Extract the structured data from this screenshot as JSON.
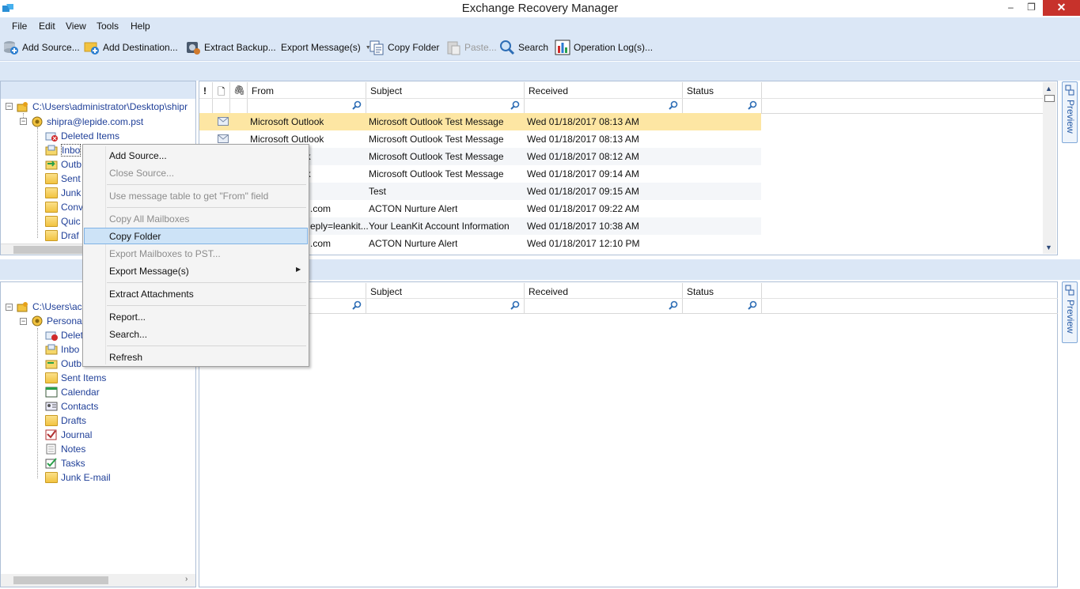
{
  "window": {
    "title": "Exchange Recovery Manager",
    "minimize": "–",
    "maximize": "❐",
    "close": "✕"
  },
  "menu": [
    "File",
    "Edit",
    "View",
    "Tools",
    "Help"
  ],
  "toolbar": [
    {
      "label": "Add Source...",
      "icon": "add-source-icon"
    },
    {
      "label": "Add Destination...",
      "icon": "add-destination-icon"
    },
    {
      "label": "Extract Backup...",
      "icon": "extract-backup-icon"
    },
    {
      "label": "Export Message(s)",
      "icon": "dropdown-arrow-icon"
    },
    {
      "label": "Copy Folder",
      "icon": "copy-folder-icon"
    },
    {
      "label": "Paste...",
      "icon": "paste-icon",
      "disabled": true
    },
    {
      "label": "Search",
      "icon": "search-icon"
    },
    {
      "label": "Operation Log(s)...",
      "icon": "operation-log-icon"
    }
  ],
  "source_tree": {
    "root": "C:\\Users\\administrator\\Desktop\\shipr",
    "mailbox": "shipra@lepide.com.pst",
    "folders": [
      "Deleted Items",
      "Inbo",
      "Outb",
      "Sent",
      "Junk",
      "Conv",
      "Quic",
      "Draf"
    ]
  },
  "dest_tree": {
    "root": "C:\\Users\\ac",
    "mailbox": "Persona",
    "folders": [
      "Delet",
      "Inbo",
      "Outb",
      "Sent Items",
      "Calendar",
      "Contacts",
      "Drafts",
      "Journal",
      "Notes",
      "Tasks",
      "Junk E-mail"
    ]
  },
  "grid_top": {
    "icon_headers": [
      "!",
      "🗋",
      "🖇"
    ],
    "headers": [
      "From",
      "Subject",
      "Received",
      "Status"
    ],
    "rows": [
      {
        "from": "Microsoft Outlook",
        "subject": "Microsoft Outlook Test Message",
        "received": "Wed 01/18/2017 08:13 AM",
        "selected": true
      },
      {
        "from": "Microsoft Outlook",
        "subject": "Microsoft Outlook Test Message",
        "received": "Wed 01/18/2017 08:13 AM"
      },
      {
        "from": "ok",
        "subject": "Microsoft Outlook Test Message",
        "received": "Wed 01/18/2017 08:12 AM"
      },
      {
        "from": "ok",
        "subject": "Microsoft Outlook Test Message",
        "received": "Wed 01/18/2017 09:14 AM"
      },
      {
        "from": "",
        "subject": "Test",
        "received": "Wed 01/18/2017 09:15 AM"
      },
      {
        "from": ".com",
        "subject": "ACTON Nurture Alert",
        "received": "Wed 01/18/2017 09:22 AM"
      },
      {
        "from": "eply=leankit...",
        "subject": "Your LeanKit Account Information",
        "received": "Wed 01/18/2017 10:38 AM"
      },
      {
        "from": ".com",
        "subject": "ACTON Nurture Alert",
        "received": "Wed 01/18/2017 12:10 PM"
      }
    ]
  },
  "grid_bottom": {
    "headers": [
      "Subject",
      "Received",
      "Status"
    ]
  },
  "context_menu": [
    {
      "label": "Add Source...",
      "disabled": false
    },
    {
      "label": "Close Source...",
      "disabled": true
    },
    {
      "label": "Use message table to get \"From\" field",
      "disabled": true
    },
    {
      "label": "Copy All Mailboxes",
      "disabled": true
    },
    {
      "label": "Copy Folder",
      "disabled": false,
      "highlighted": true
    },
    {
      "label": "Export Mailboxes to PST...",
      "disabled": true
    },
    {
      "label": "Export Message(s)",
      "disabled": false,
      "submenu": true
    },
    {
      "label": "Extract Attachments",
      "disabled": false
    },
    {
      "label": "Report...",
      "disabled": false
    },
    {
      "label": "Search...",
      "disabled": false
    },
    {
      "label": "Refresh",
      "disabled": false
    }
  ],
  "preview_label": "Preview",
  "colors": {
    "chrome": "#dbe7f6",
    "selected_row": "#fde6a3",
    "close": "#c7322b",
    "tree_text": "#1f3f98"
  }
}
